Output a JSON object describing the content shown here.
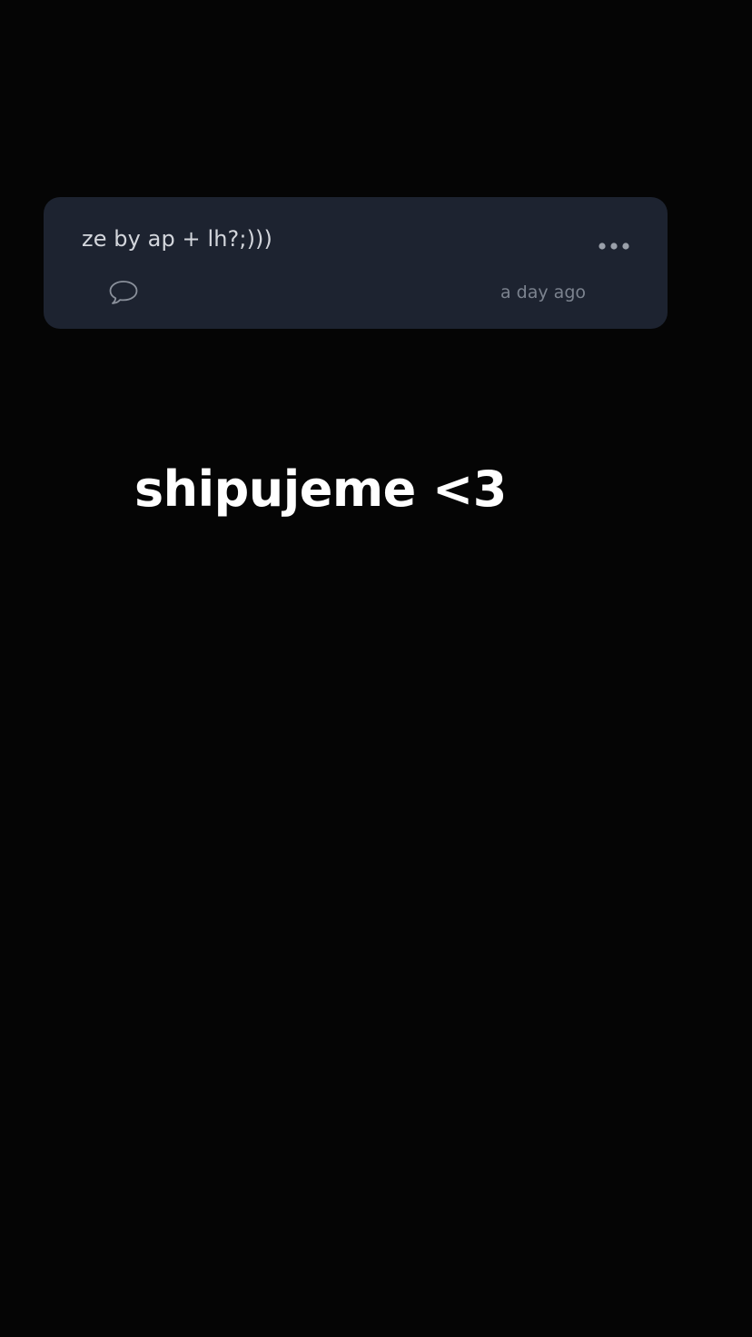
{
  "post": {
    "text": "ze by ap + lh?;)))",
    "timestamp": "a day ago",
    "more_icon": "more-horizontal-icon",
    "comment_icon": "comment-bubble-icon"
  },
  "story": {
    "caption": "shipujeme <3"
  },
  "colors": {
    "background": "#050505",
    "card": "#1d2330",
    "post_text": "#d3d6dc",
    "timestamp": "#7c838f",
    "caption": "#ffffff"
  }
}
